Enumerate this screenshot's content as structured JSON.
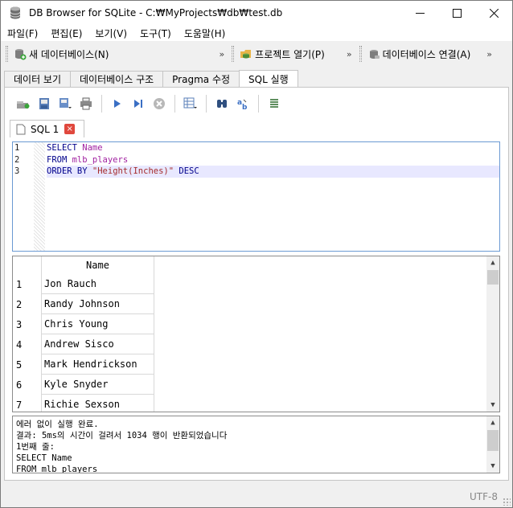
{
  "window": {
    "title": "DB Browser for SQLite - C:₩MyProjects₩db₩test.db"
  },
  "menu": [
    "파일(F)",
    "편집(E)",
    "보기(V)",
    "도구(T)",
    "도움말(H)"
  ],
  "toolbar": {
    "new_db": "새 데이터베이스(N)",
    "open_project": "프로젝트 열기(P)",
    "attach_db": "데이터베이스 연결(A)",
    "more": "»"
  },
  "tabs": [
    "데이터 보기",
    "데이터베이스 구조",
    "Pragma 수정",
    "SQL 실행"
  ],
  "active_tab": "SQL 실행",
  "sql_tab": {
    "label": "SQL 1",
    "close": "×"
  },
  "editor": {
    "line_numbers": [
      "1",
      "2",
      "3"
    ],
    "lines": [
      [
        {
          "t": "SELECT ",
          "c": "kw"
        },
        {
          "t": "Name",
          "c": "id"
        }
      ],
      [
        {
          "t": "FROM ",
          "c": "kw"
        },
        {
          "t": "mlb_players",
          "c": "id"
        }
      ],
      [
        {
          "t": "ORDER BY ",
          "c": "kw"
        },
        {
          "t": "\"Height(Inches)\"",
          "c": "str"
        },
        {
          "t": " DESC",
          "c": "kw"
        }
      ]
    ],
    "current_line": 3
  },
  "results": {
    "column": "Name",
    "rows": [
      {
        "n": "1",
        "name": "Jon Rauch"
      },
      {
        "n": "2",
        "name": "Randy Johnson"
      },
      {
        "n": "3",
        "name": "Chris Young"
      },
      {
        "n": "4",
        "name": "Andrew Sisco"
      },
      {
        "n": "5",
        "name": "Mark Hendrickson"
      },
      {
        "n": "6",
        "name": "Kyle Snyder"
      },
      {
        "n": "7",
        "name": "Richie Sexson"
      }
    ]
  },
  "messages": [
    "에러 없이 실행 완료.",
    "결과: 5ms의 시간이 걸려서 1034 행이 반환되었습니다",
    "1번째 줄:",
    "SELECT Name",
    "FROM mlb_players"
  ],
  "status": {
    "encoding": "UTF-8"
  },
  "colors": {
    "editor_border": "#6b9ad3",
    "keyword": "#00008b",
    "identifier": "#a020a0",
    "string": "#a52a2a",
    "current_line": "#e8e8ff"
  }
}
